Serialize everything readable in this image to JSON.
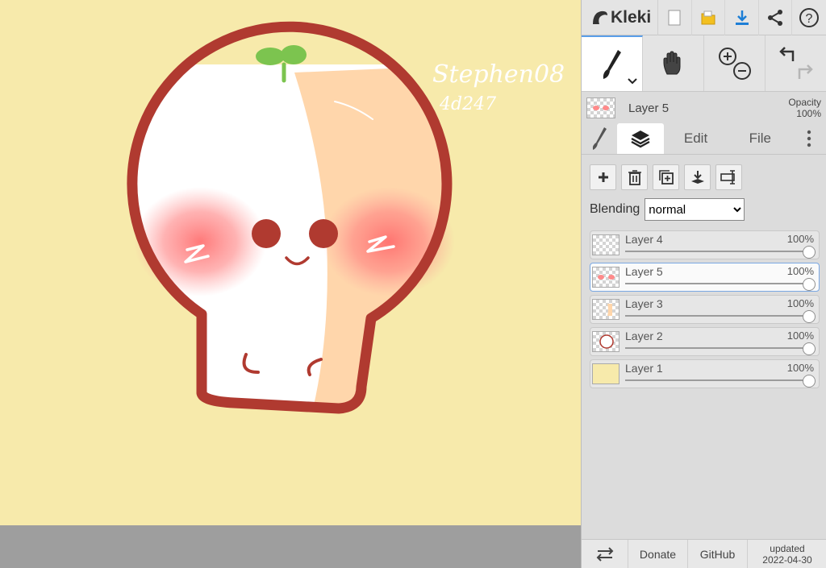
{
  "app": {
    "name": "Kleki"
  },
  "toolbar": {
    "icons": [
      "new-image-icon",
      "save-icon",
      "download-icon",
      "share-icon",
      "help-icon"
    ]
  },
  "tools": {
    "brush_icon": "brush-icon",
    "hand_icon": "hand-icon",
    "zoom_icons": [
      "zoom-in-icon",
      "zoom-out-icon"
    ],
    "history_icons": [
      "undo-icon",
      "redo-icon"
    ]
  },
  "current_layer": {
    "name": "Layer 5",
    "opacity_label": "Opacity",
    "opacity_value": "100%"
  },
  "tabs": {
    "edit": "Edit",
    "file": "File"
  },
  "layers_panel": {
    "blending_label": "Blending",
    "blending_value": "normal",
    "blending_options": [
      "normal"
    ],
    "layers": [
      {
        "name": "Layer 4",
        "opacity": "100%",
        "selected": false,
        "opacity_fraction": 1.0
      },
      {
        "name": "Layer 5",
        "opacity": "100%",
        "selected": true,
        "opacity_fraction": 1.0
      },
      {
        "name": "Layer 3",
        "opacity": "100%",
        "selected": false,
        "opacity_fraction": 1.0
      },
      {
        "name": "Layer 2",
        "opacity": "100%",
        "selected": false,
        "opacity_fraction": 1.0
      },
      {
        "name": "Layer 1",
        "opacity": "100%",
        "selected": false,
        "opacity_fraction": 1.0
      }
    ]
  },
  "footer": {
    "donate": "Donate",
    "github": "GitHub",
    "updated_label": "updated",
    "updated_date": "2022-04-30"
  },
  "canvas": {
    "background_color": "#f7eaab",
    "signature_line1": "Stephen08",
    "signature_line2": "4d247"
  },
  "colors": {
    "accent": "#5a9ee8",
    "outline": "#b03a30",
    "download_blue": "#1e7fd6",
    "save_yellow": "#f3c020"
  }
}
